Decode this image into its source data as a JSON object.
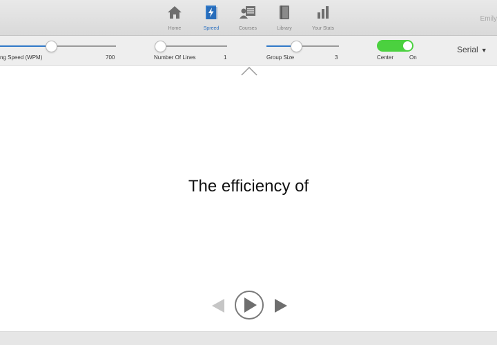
{
  "nav": {
    "items": [
      {
        "label": "Home",
        "icon": "home-icon"
      },
      {
        "label": "Spreed",
        "icon": "spreed-bolt-icon"
      },
      {
        "label": "Courses",
        "icon": "courses-icon"
      },
      {
        "label": "Library",
        "icon": "library-book-icon"
      },
      {
        "label": "Your Stats",
        "icon": "stats-bar-icon"
      }
    ],
    "active": "Spreed",
    "user_name": "Emily"
  },
  "controls": {
    "speed": {
      "label": "ng Speed (WPM)",
      "value": "700"
    },
    "lines": {
      "label": "Number Of Lines",
      "value": "1"
    },
    "group": {
      "label": "Group Size",
      "value": "3"
    },
    "center": {
      "label": "Center",
      "state": "On"
    },
    "mode": {
      "selected": "Serial",
      "arrow": "▼"
    }
  },
  "reader": {
    "text": "The efficiency of"
  },
  "colors": {
    "accent": "#2f78c8",
    "toggle_on": "#4bd13f",
    "icon_gray": "#6e6e6e"
  }
}
